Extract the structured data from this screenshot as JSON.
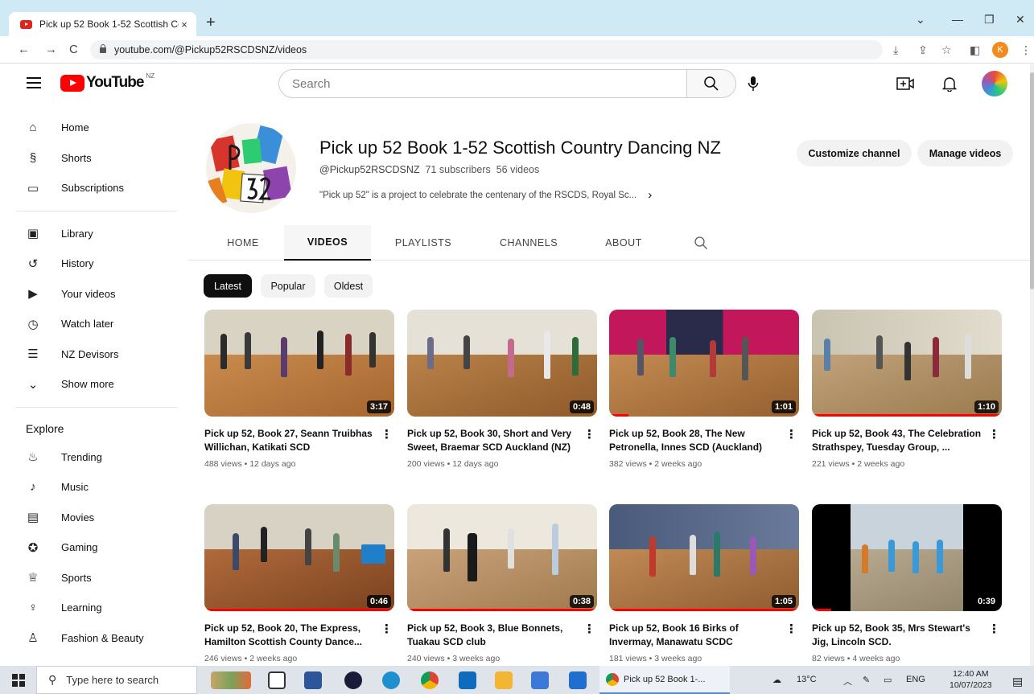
{
  "browser": {
    "tab_title": "Pick up 52 Book 1-52 Scottish Co",
    "tab_close": "×",
    "new_tab": "+",
    "url": "youtube.com/@Pickup52RSCDSNZ/videos",
    "profile_initial": "K"
  },
  "youtube": {
    "logo_text": "YouTube",
    "country_code": "NZ",
    "search_placeholder": "Search"
  },
  "sidebar": {
    "main": [
      {
        "label": "Home",
        "icon": "home-icon"
      },
      {
        "label": "Shorts",
        "icon": "shorts-icon"
      },
      {
        "label": "Subscriptions",
        "icon": "subscriptions-icon"
      }
    ],
    "you": [
      {
        "label": "Library",
        "icon": "library-icon"
      },
      {
        "label": "History",
        "icon": "history-icon"
      },
      {
        "label": "Your videos",
        "icon": "your-videos-icon"
      },
      {
        "label": "Watch later",
        "icon": "watch-later-icon"
      },
      {
        "label": "NZ Devisors",
        "icon": "playlist-icon"
      },
      {
        "label": "Show more",
        "icon": "chevron-down-icon"
      }
    ],
    "explore_title": "Explore",
    "explore": [
      {
        "label": "Trending",
        "icon": "trending-icon"
      },
      {
        "label": "Music",
        "icon": "music-icon"
      },
      {
        "label": "Movies",
        "icon": "movies-icon"
      },
      {
        "label": "Gaming",
        "icon": "gaming-icon"
      },
      {
        "label": "Sports",
        "icon": "sports-icon"
      },
      {
        "label": "Learning",
        "icon": "learning-icon"
      },
      {
        "label": "Fashion & Beauty",
        "icon": "fashion-icon"
      }
    ]
  },
  "channel": {
    "name": "Pick up 52 Book 1-52 Scottish Country Dancing NZ",
    "handle": "@Pickup52RSCDSNZ",
    "subscribers": "71 subscribers",
    "videos_count": "56 videos",
    "description": "\"Pick up 52\" is a project to celebrate the centenary of the RSCDS, Royal Sc...",
    "more_glyph": "›",
    "customize_label": "Customize channel",
    "manage_label": "Manage videos"
  },
  "tabs": [
    "HOME",
    "VIDEOS",
    "PLAYLISTS",
    "CHANNELS",
    "ABOUT"
  ],
  "active_tab": "VIDEOS",
  "chips": [
    "Latest",
    "Popular",
    "Oldest"
  ],
  "active_chip": "Latest",
  "videos": [
    {
      "title": "Pick up 52, Book 27, Seann Truibhas Willichan, Katikati SCD",
      "views": "488 views",
      "age": "12 days ago",
      "duration": "3:17",
      "watched": 0
    },
    {
      "title": "Pick up 52, Book 30, Short and Very Sweet, Braemar SCD Auckland (NZ)",
      "views": "200 views",
      "age": "12 days ago",
      "duration": "0:48",
      "watched": 0
    },
    {
      "title": "Pick up 52, Book 28, The New Petronella, Innes SCD (Auckland)",
      "views": "382 views",
      "age": "2 weeks ago",
      "duration": "1:01",
      "watched": 0.1
    },
    {
      "title": "Pick up 52, Book 43, The Celebration Strathspey, Tuesday Group, ...",
      "views": "221 views",
      "age": "2 weeks ago",
      "duration": "1:10",
      "watched": 1
    },
    {
      "title": "Pick up 52, Book 20, The Express, Hamilton Scottish County Dance...",
      "views": "246 views",
      "age": "2 weeks ago",
      "duration": "0:46",
      "watched": 1
    },
    {
      "title": "Pick up 52, Book 3, Blue Bonnets, Tuakau SCD club",
      "views": "240 views",
      "age": "3 weeks ago",
      "duration": "0:38",
      "watched": 1
    },
    {
      "title": "Pick up 52, Book 16 Birks of Invermay, Manawatu SCDC",
      "views": "181 views",
      "age": "3 weeks ago",
      "duration": "1:05",
      "watched": 1
    },
    {
      "title": "Pick up 52, Book 35, Mrs Stewart's Jig, Lincoln SCD.",
      "views": "82 views",
      "age": "4 weeks ago",
      "duration": "0:39",
      "watched": 0.1
    }
  ],
  "taskbar": {
    "search_placeholder": "Type here to search",
    "active_window": "Pick up 52 Book 1-...",
    "temperature": "13°C",
    "language": "ENG",
    "time": "12:40 AM",
    "date": "10/07/2023"
  }
}
